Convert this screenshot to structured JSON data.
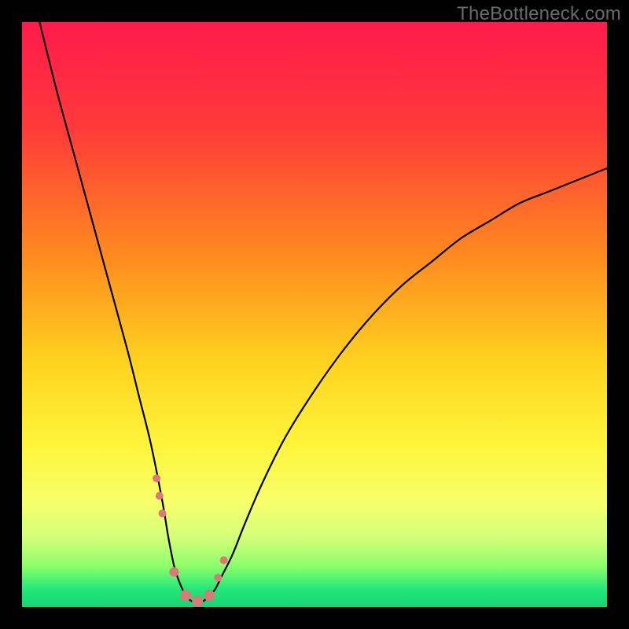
{
  "watermark": "TheBottleneck.com",
  "chart_data": {
    "type": "line",
    "title": "",
    "xlabel": "",
    "ylabel": "",
    "xlim": [
      0,
      100
    ],
    "ylim": [
      0,
      100
    ],
    "series": [
      {
        "name": "curve",
        "x": [
          3,
          6,
          9,
          12,
          15,
          18,
          20,
          22,
          24,
          25,
          26,
          27,
          28,
          29,
          30,
          31,
          32,
          33,
          34,
          36,
          38,
          41,
          45,
          50,
          55,
          60,
          65,
          70,
          75,
          80,
          85,
          90,
          95,
          100
        ],
        "y": [
          100,
          88,
          77,
          66,
          55,
          44,
          36,
          28,
          18,
          12,
          7,
          4,
          2,
          1,
          1,
          1,
          2,
          3,
          5,
          9,
          14,
          21,
          29,
          37,
          44,
          50,
          55,
          59,
          63,
          66,
          69,
          71,
          73,
          75
        ]
      }
    ],
    "markers": {
      "name": "dots",
      "x": [
        23.0,
        23.5,
        24.0,
        26.0,
        28.0,
        30.0,
        32.0,
        33.5,
        34.5
      ],
      "y": [
        22,
        19,
        16,
        6,
        2,
        1,
        2,
        5,
        8
      ],
      "size": [
        10,
        10,
        10,
        12,
        14,
        14,
        14,
        10,
        10
      ]
    },
    "gradient_stops": [
      {
        "offset": 0.0,
        "color": "#ff1a4b"
      },
      {
        "offset": 0.18,
        "color": "#ff3a3a"
      },
      {
        "offset": 0.4,
        "color": "#ff8a1f"
      },
      {
        "offset": 0.58,
        "color": "#ffd21f"
      },
      {
        "offset": 0.72,
        "color": "#fff43a"
      },
      {
        "offset": 0.82,
        "color": "#f7ff6a"
      },
      {
        "offset": 0.88,
        "color": "#d4ff7a"
      },
      {
        "offset": 0.93,
        "color": "#8cff6a"
      },
      {
        "offset": 0.97,
        "color": "#22e77a"
      },
      {
        "offset": 1.0,
        "color": "#17d472"
      }
    ],
    "marker_color": "#d87a78",
    "curve_color": "#000000"
  }
}
